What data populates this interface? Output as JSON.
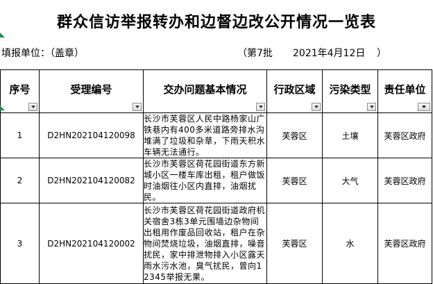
{
  "title": "群众信访举报转办和边督边改公开情况一览表",
  "header_info": {
    "reporter_label": "填报单位：（盖章）",
    "batch": "（第7批",
    "date": "2021年4月12日",
    "date_end": "）"
  },
  "columns": [
    {
      "label": "序号"
    },
    {
      "label": "受理编号"
    },
    {
      "label": "交办问题基本情况"
    },
    {
      "label": "行政区域"
    },
    {
      "label": "污染类型"
    },
    {
      "label": "责任单位"
    }
  ],
  "rows": [
    {
      "no": "1",
      "id": "D2HN202104120098",
      "desc": "长沙市芙蓉区人民中路杨家山广铁巷内有400多米道路旁排水沟堆满了垃圾和杂草，下雨天积水车辆无法通行。",
      "region": "芙蓉区",
      "type": "土壤",
      "unit": "芙蓉区政府"
    },
    {
      "no": "2",
      "id": "D2HN202104120082",
      "desc": "长沙市芙蓉区荷花园街道东方新城小区一楼车库出租，租户做饭时油烟往小区内直排，油烟扰民。",
      "region": "芙蓉区",
      "type": "大气",
      "unit": "芙蓉区政府"
    },
    {
      "no": "3",
      "id": "D2HN202104120002",
      "desc": "长沙市芙蓉区荷花园街道政府机关宿舍3栋3单元围墙边杂物间出租用作废品回收站，租户在杂物间焚烧垃圾，油烟直排，噪音扰民，家中排泄物排入小区露天雨水污水池，臭气扰民，曾向12345举报无果。",
      "region": "芙蓉区",
      "type": "水",
      "unit": "芙蓉区政府"
    }
  ],
  "icons": {
    "filter": "dropdown-arrow-icon",
    "filter_active": "filter-funnel-icon"
  }
}
